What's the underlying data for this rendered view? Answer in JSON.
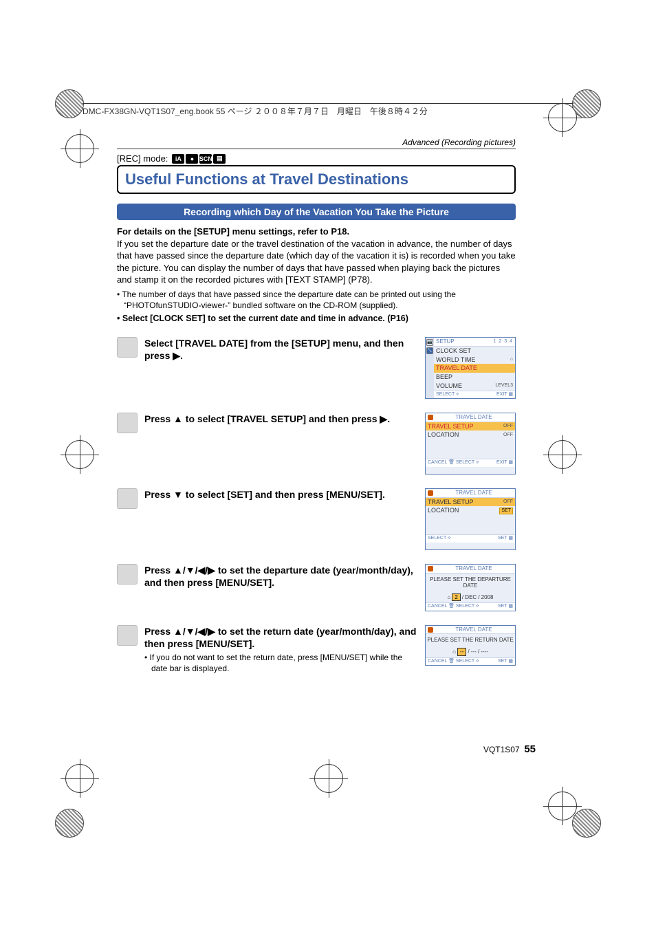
{
  "book_header": "DMC-FX38GN-VQT1S07_eng.book  55 ページ  ２００８年７月７日　月曜日　午後８時４２分",
  "section_label": "Advanced (Recording pictures)",
  "rec_mode_label": "[REC] mode:",
  "mode_icons": [
    "iA",
    "●",
    "SCN",
    "▤"
  ],
  "title": "Useful Functions at Travel Destinations",
  "sub_bar": "Recording which Day of the Vacation You Take the Picture",
  "intro_bold": "For details on the [SETUP] menu settings, refer to P18.",
  "intro_body": "If you set the departure date or the travel destination of the vacation in advance, the number of days that have passed since the departure date (which day of the vacation it is) is recorded when you take the picture. You can display the number of days that have passed when playing back the pictures and stamp it on the recorded pictures with [TEXT STAMP] (P78).",
  "bullet1": "• The number of days that have passed since the departure date can be printed out using the “PHOTOfunSTUDIO-viewer-” bundled software on the CD-ROM (supplied).",
  "bullet2": "• Select [CLOCK SET] to set the current date and time in advance. (P16)",
  "steps": [
    {
      "text": "Select [TRAVEL DATE] from the [SETUP] menu, and then press ▶."
    },
    {
      "text": "Press ▲ to select [TRAVEL SETUP] and then press ▶."
    },
    {
      "text": "Press ▼ to select [SET] and then press [MENU/SET]."
    },
    {
      "text": "Press ▲/▼/◀/▶ to set the departure date (year/month/day), and then press [MENU/SET]."
    },
    {
      "text": "Press ▲/▼/◀/▶ to set the return date (year/month/day), and then press [MENU/SET].",
      "note": "• If you do not want to set the return date, press [MENU/SET] while the date bar is displayed."
    }
  ],
  "screenshot1": {
    "title": "SETUP",
    "tabs": "1 2 3 4",
    "rows": [
      {
        "icon": "⏲",
        "label": "CLOCK SET",
        "right": ""
      },
      {
        "icon": "🌐",
        "label": "WORLD TIME",
        "right": "⌂"
      },
      {
        "icon": "🧳",
        "label": "TRAVEL DATE",
        "right": "",
        "hl": true
      },
      {
        "icon": "•))",
        "label": "BEEP",
        "right": ""
      },
      {
        "icon": "🔊",
        "label": "VOLUME",
        "right": "LEVEL3"
      }
    ],
    "foot_l": "SELECT ⟡",
    "foot_r": "EXIT ▦"
  },
  "screenshot2": {
    "title": "TRAVEL DATE",
    "rows": [
      {
        "label": "TRAVEL SETUP",
        "right": "OFF",
        "hl": true
      },
      {
        "label": "LOCATION",
        "right": "OFF"
      }
    ],
    "foot_l": "CANCEL 🗑 SELECT ⟡",
    "foot_r": "EXIT ▦"
  },
  "screenshot3": {
    "title": "TRAVEL DATE",
    "rows": [
      {
        "label": "TRAVEL SETUP",
        "right": "OFF",
        "hl": true
      },
      {
        "label": "LOCATION",
        "right": "SET",
        "tag": true
      }
    ],
    "foot_l": "SELECT ⟡",
    "foot_r": "SET ▦"
  },
  "screenshot4": {
    "title": "TRAVEL DATE",
    "msg": "PLEASE SET THE DEPARTURE DATE",
    "date_parts": [
      "2",
      "/ DEC /",
      "2008"
    ],
    "foot_l": "CANCEL 🗑 SELECT ⟡",
    "foot_r": "SET ▦"
  },
  "screenshot5": {
    "title": "TRAVEL DATE",
    "msg": "PLEASE SET THE RETURN DATE",
    "date_parts": [
      "--",
      "/ --- /",
      "----"
    ],
    "foot_l": "CANCEL 🗑 SELECT ⟡",
    "foot_r": "SET ▦"
  },
  "footer_code": "VQT1S07",
  "footer_page": "55"
}
